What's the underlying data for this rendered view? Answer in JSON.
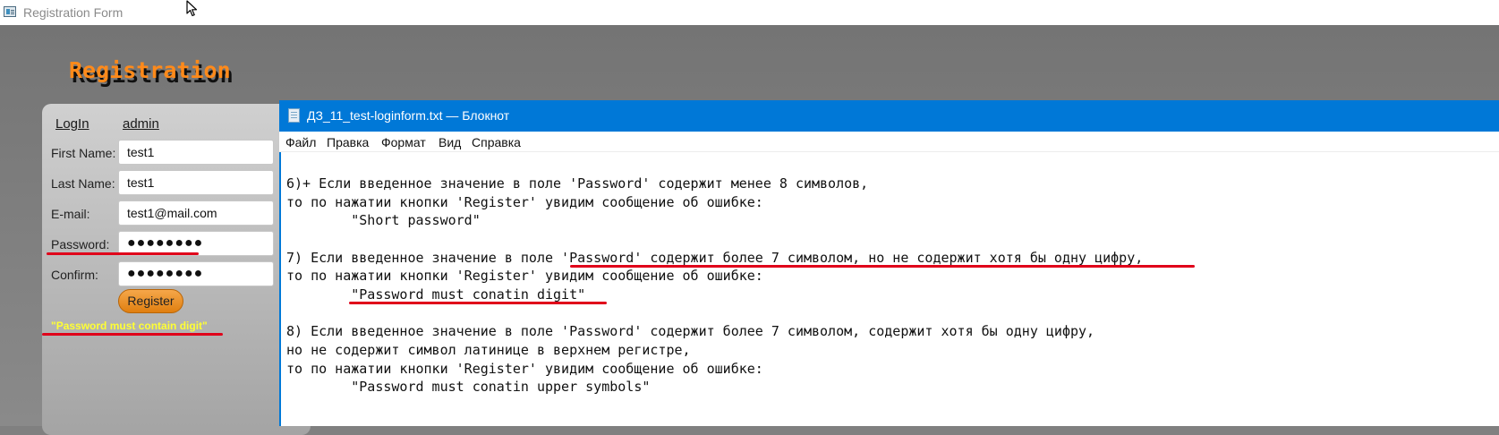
{
  "registration_window": {
    "title": "Registration Form",
    "heading": "Registration",
    "links": {
      "login": "LogIn",
      "admin": "admin"
    },
    "fields": [
      {
        "label": "First Name:",
        "value": "test1"
      },
      {
        "label": "Last Name:",
        "value": "test1"
      },
      {
        "label": "E-mail:",
        "value": "test1@mail.com"
      },
      {
        "label": "Password:",
        "value": "●●●●●●●●"
      },
      {
        "label": "Confirm:",
        "value": "●●●●●●●●"
      }
    ],
    "register_label": "Register",
    "error_message": "\"Password must contain digit\""
  },
  "notepad": {
    "title": "ДЗ_11_test-loginform.txt — Блокнот",
    "menu": [
      "Файл",
      "Правка",
      "Формат",
      "Вид",
      "Справка"
    ],
    "lines": [
      "6)+ Если введенное значение в поле 'Password' содержит менее 8 символов,",
      "то по нажатии кнопки 'Register' увидим сообщение об ошибке:",
      "        \"Short password\"",
      "",
      "7) Если введенное значение в поле 'Password' содержит более 7 символом, но не содержит хотя бы одну цифру,",
      "то по нажатии кнопки 'Register' увидим сообщение об ошибке:",
      "        \"Password must conatin digit\"",
      "",
      "8) Если введенное значение в поле 'Password' содержит более 7 символом, содержит хотя бы одну цифру,",
      "но не содержит символ латинице в верхнем регистре,",
      "то по нажатии кнопки 'Register' увидим сообщение об ошибке:",
      "        \"Password must conatin upper symbols\""
    ]
  },
  "colors": {
    "heading_orange": "#ff8a1a",
    "error_yellow": "#ffff33",
    "annotation_red": "#e0001a",
    "notepad_accent": "#0078d7"
  },
  "icons": [
    "app-window-icon",
    "mouse-cursor-icon",
    "notepad-file-icon"
  ]
}
